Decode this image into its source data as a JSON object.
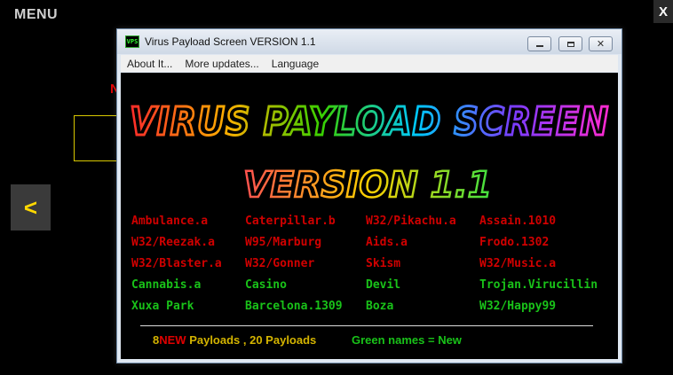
{
  "app": {
    "menu_label": "MENU",
    "close_label": "X",
    "back_label": "<",
    "partial_letter": "N"
  },
  "window": {
    "title": "Virus Payload Screen VERSION 1.1",
    "icon_text": "VPS",
    "menu": [
      "About It...",
      "More updates...",
      "Language"
    ],
    "banner_title": "VIRUS PAYLOAD SCREEN",
    "banner_version": "VERSION 1.1"
  },
  "payloads": {
    "rows": [
      [
        {
          "name": "Ambulance.a",
          "new": false
        },
        {
          "name": "Caterpillar.b",
          "new": false
        },
        {
          "name": "W32/Pikachu.a",
          "new": false
        },
        {
          "name": "Assain.1010",
          "new": false
        }
      ],
      [
        {
          "name": "W32/Reezak.a",
          "new": false
        },
        {
          "name": "W95/Marburg",
          "new": false
        },
        {
          "name": "Aids.a",
          "new": false
        },
        {
          "name": "Frodo.1302",
          "new": false
        }
      ],
      [
        {
          "name": "W32/Blaster.a",
          "new": false
        },
        {
          "name": "W32/Gonner",
          "new": false
        },
        {
          "name": "Skism",
          "new": false
        },
        {
          "name": "W32/Music.a",
          "new": false
        }
      ],
      [
        {
          "name": "Cannabis.a",
          "new": true
        },
        {
          "name": "Casino",
          "new": true
        },
        {
          "name": "Devil",
          "new": true
        },
        {
          "name": "Trojan.Virucillin",
          "new": true
        }
      ],
      [
        {
          "name": "Xuxa Park",
          "new": true
        },
        {
          "name": "Barcelona.1309",
          "new": true
        },
        {
          "name": "Boza",
          "new": true
        },
        {
          "name": "W32/Happy99",
          "new": true
        }
      ]
    ]
  },
  "footer": {
    "new_count": "8",
    "new_word": "NEW",
    "rest": " Payloads , 20 Payloads",
    "legend": "Green names = New"
  },
  "colors": {
    "old_payload": "#d00000",
    "new_payload": "#19c219",
    "accent_yellow": "#d4b400"
  }
}
